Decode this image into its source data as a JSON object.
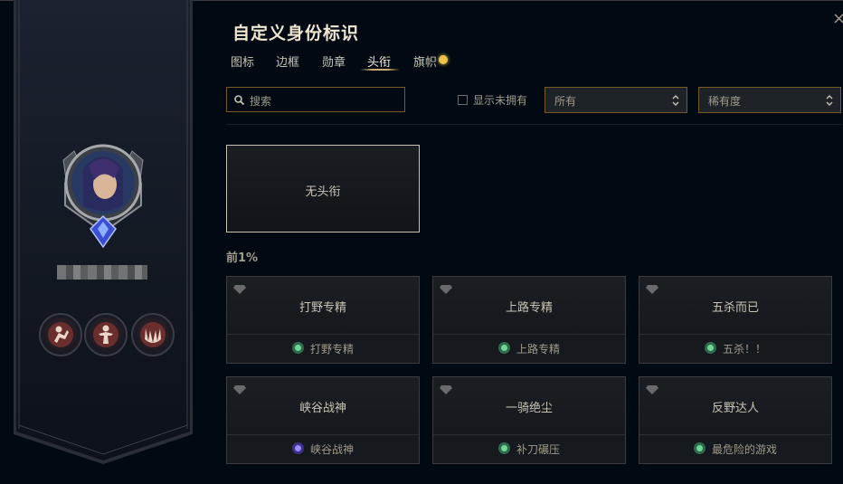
{
  "window": {
    "title": "自定义身份标识",
    "close_symbol": "×"
  },
  "tabs": [
    {
      "label": "图标",
      "active": false
    },
    {
      "label": "边框",
      "active": false
    },
    {
      "label": "勋章",
      "active": false
    },
    {
      "label": "头衔",
      "active": true
    },
    {
      "label": "旗帜",
      "active": false,
      "notification_dot": true
    }
  ],
  "filters": {
    "search_placeholder": "搜索",
    "show_unowned_label": "显示未拥有",
    "show_unowned_checked": false,
    "ownership_select": "所有",
    "sort_select": "稀有度"
  },
  "no_title_option": "无头衔",
  "section_label": "前1%",
  "colors": {
    "accent_gold": "#c8aa6e",
    "border_gold": "#785a28",
    "notification": "#e8c24a",
    "challenge_green": "#4caf7a",
    "challenge_purple": "#6b5ad6"
  },
  "titles": [
    {
      "name": "打野专精",
      "challenge": "打野专精",
      "challenge_icon": "green-challenge-icon"
    },
    {
      "name": "上路专精",
      "challenge": "上路专精",
      "challenge_icon": "green-challenge-icon"
    },
    {
      "name": "五杀而已",
      "challenge": "五杀！！",
      "challenge_icon": "green-challenge-icon"
    },
    {
      "name": "峡谷战神",
      "challenge": "峡谷战神",
      "challenge_icon": "purple-challenge-icon"
    },
    {
      "name": "一骑绝尘",
      "challenge": "补刀碾压",
      "challenge_icon": "green-challenge-icon"
    },
    {
      "name": "反野达人",
      "challenge": "最危险的游戏",
      "challenge_icon": "green-challenge-icon"
    }
  ]
}
